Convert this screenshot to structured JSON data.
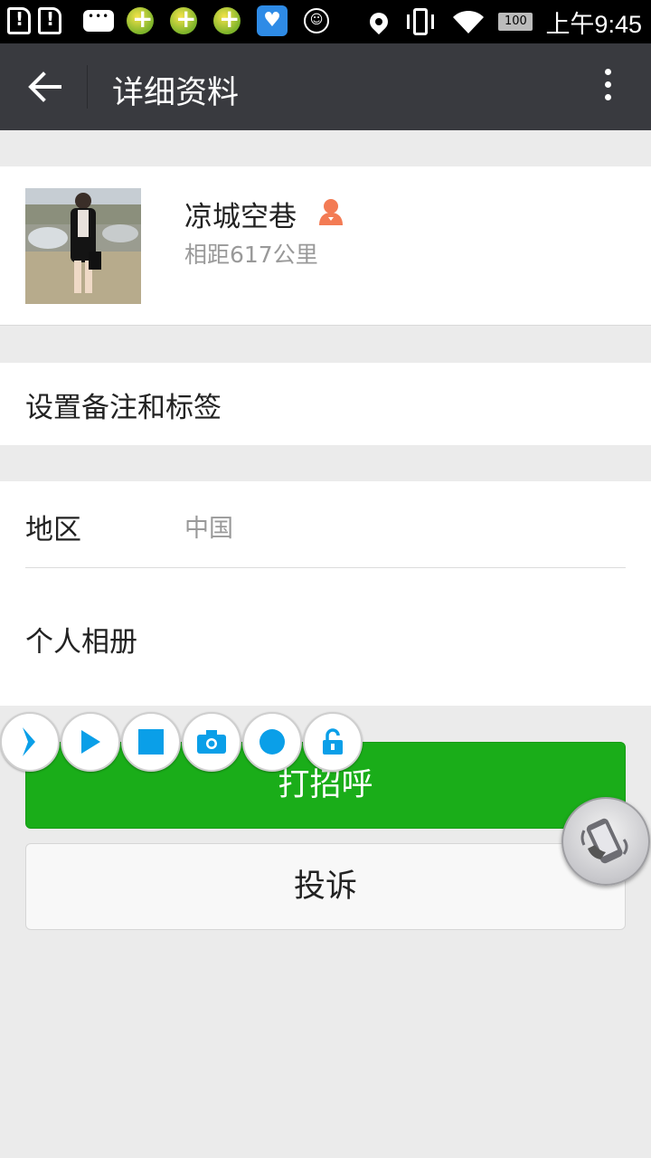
{
  "status_bar": {
    "time": "上午9:45",
    "battery": "100",
    "icons": [
      "sim-alert-icon",
      "sim-alert-icon",
      "message-icon",
      "plus-ball-icon",
      "plus-ball-icon",
      "plus-ball-icon",
      "health-heart-icon",
      "face-icon",
      "location-icon",
      "vibrate-icon",
      "wifi-icon",
      "battery-icon"
    ]
  },
  "app_bar": {
    "title": "详细资料",
    "back_icon": "arrow-left-icon",
    "more_icon": "more-vertical-icon"
  },
  "profile": {
    "name": "凉城空巷",
    "gender_icon": "female-icon",
    "gender_color": "#f37b54",
    "distance": "相距617公里"
  },
  "remark": {
    "label": "设置备注和标签"
  },
  "info": {
    "region_label": "地区",
    "region_value": "中国",
    "album_label": "个人相册"
  },
  "actions": {
    "greet_label": "打招呼",
    "greet_color": "#1aad19",
    "report_label": "投诉"
  },
  "recorder_toolbar": {
    "icons": [
      "chevron-right-icon",
      "play-icon",
      "stop-icon",
      "camera-icon",
      "record-icon",
      "unlock-icon"
    ],
    "accent": "#0a9fe8"
  },
  "floating_ball": {
    "icon": "shake-phone-icon"
  }
}
